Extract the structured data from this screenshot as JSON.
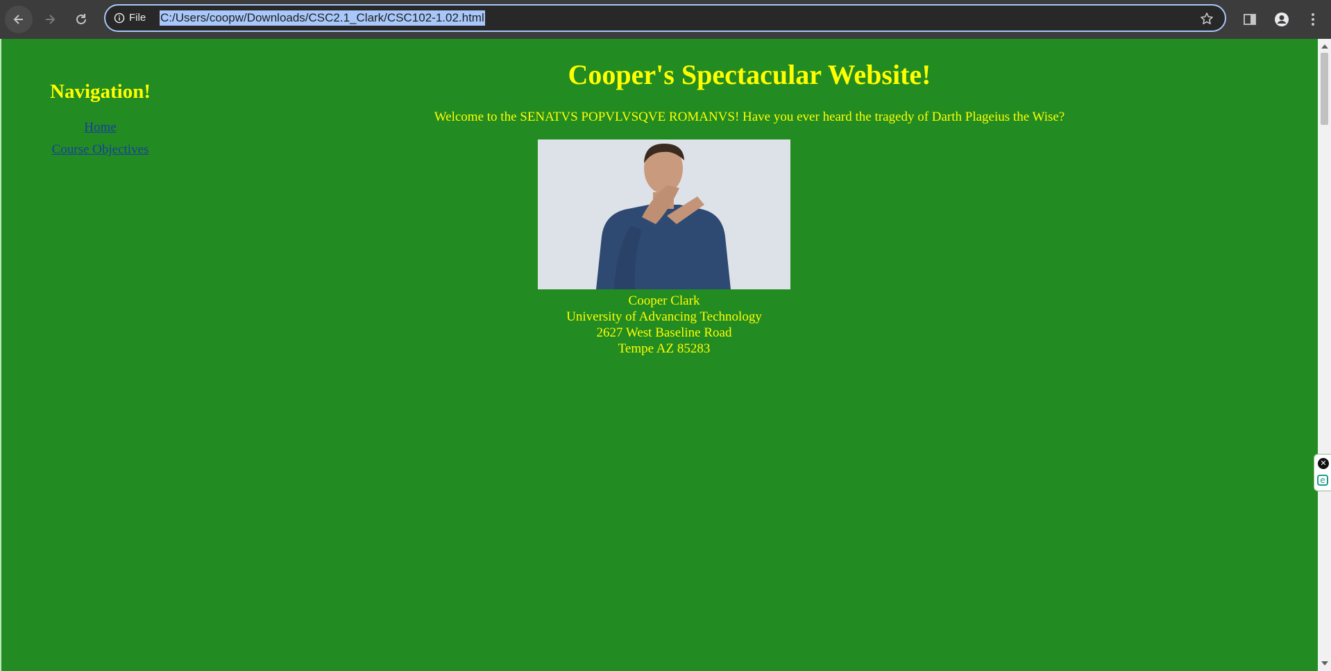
{
  "browser": {
    "site_info_label": "File",
    "url": "C:/Users/coopw/Downloads/CSC2.1_Clark/CSC102-1.02.html",
    "accent": "#a8c7fa"
  },
  "page": {
    "background_color": "#228b22",
    "text_color": "#ffff00",
    "title": "Cooper's Spectacular Website!",
    "welcome": "Welcome to the SENATVS POPVLVSQVE ROMANVS! Have you ever heard the tragedy of Darth Plageius the Wise?",
    "navigation": {
      "heading": "Navigation!",
      "links": [
        {
          "label": "Home"
        },
        {
          "label": "Course Objectives"
        }
      ]
    },
    "address": {
      "name": "Cooper Clark",
      "school": "University of Advancing Technology",
      "street": "2627 West Baseline Road",
      "city": "Tempe AZ 85283"
    }
  },
  "extension_widget": {
    "close_glyph": "✕",
    "logo_letter": "e"
  }
}
